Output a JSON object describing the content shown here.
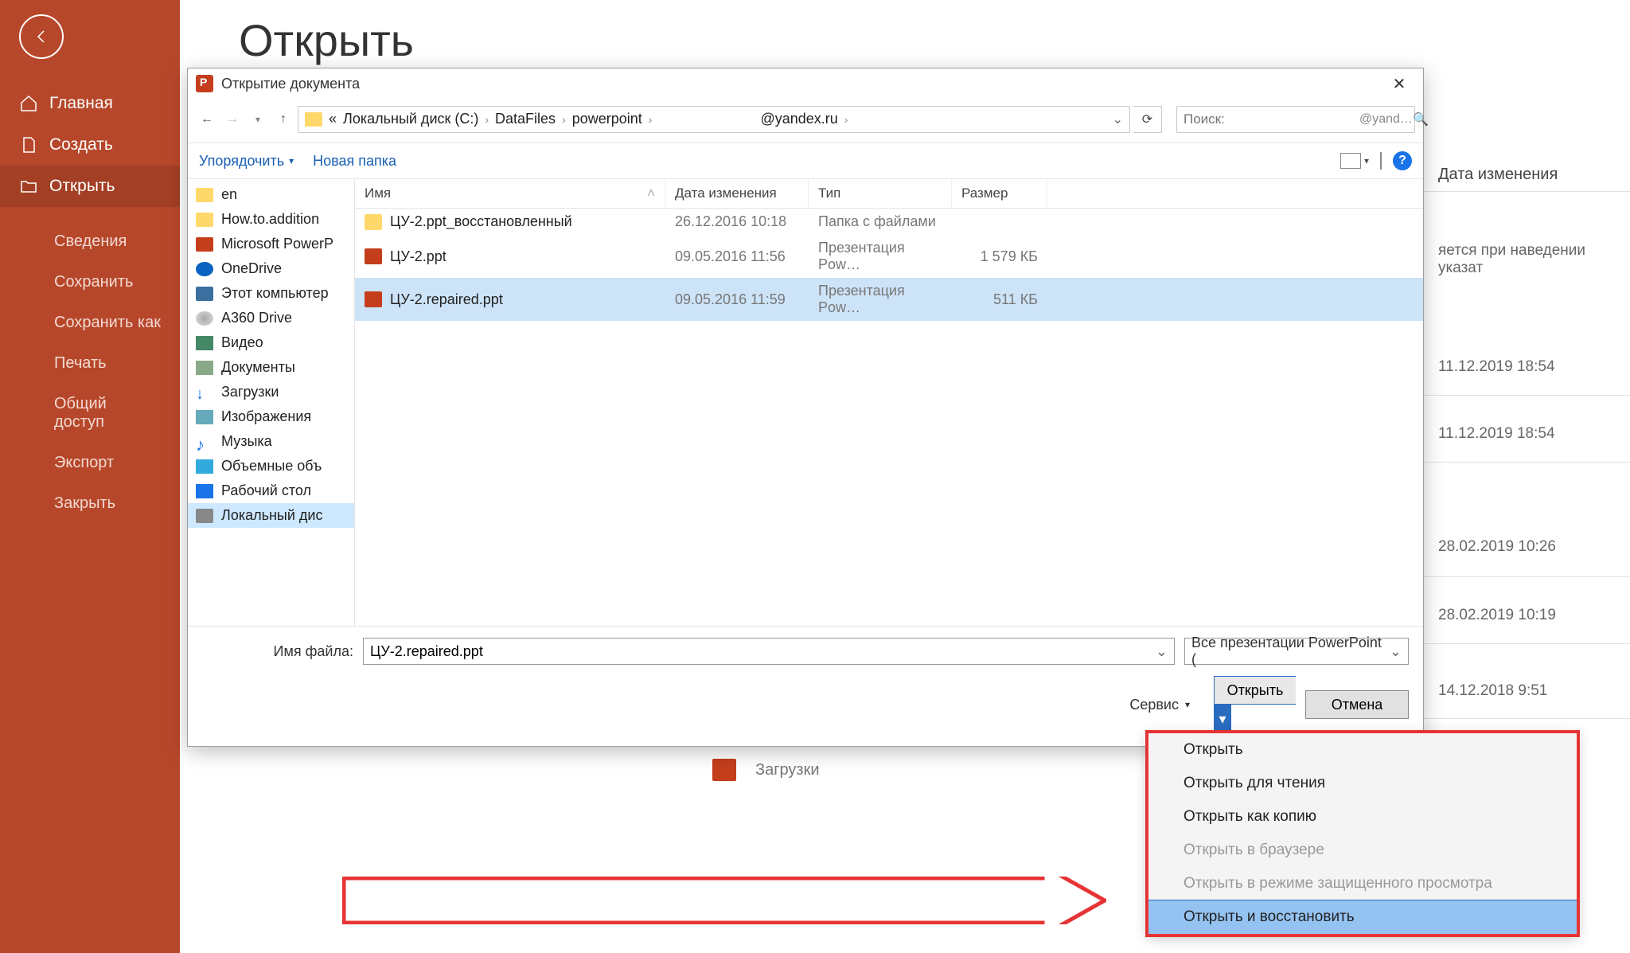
{
  "sidebar": {
    "items": [
      {
        "label": "Главная"
      },
      {
        "label": "Создать"
      },
      {
        "label": "Открыть"
      },
      {
        "label": "Сведения"
      },
      {
        "label": "Сохранить"
      },
      {
        "label": "Сохранить как"
      },
      {
        "label": "Печать"
      },
      {
        "label": "Общий доступ"
      },
      {
        "label": "Экспорт"
      },
      {
        "label": "Закрыть"
      }
    ]
  },
  "page": {
    "title": "Открыть"
  },
  "background": {
    "column_header": "Дата изменения",
    "hint_fragment": "яется при наведении указат",
    "dates": [
      "11.12.2019 18:54",
      "11.12.2019 18:54",
      "28.02.2019 10:26",
      "28.02.2019 10:19",
      "14.12.2018 9:51"
    ],
    "loads_label": "Загрузки"
  },
  "dialog": {
    "title": "Открытие документа",
    "breadcrumb": {
      "prefix": "«",
      "parts": [
        "Локальный диск (C:)",
        "DataFiles",
        "powerpoint",
        "@yandex.ru"
      ]
    },
    "search": {
      "placeholder": "Поиск:",
      "suffix": "@yand…"
    },
    "toolbar": {
      "organize": "Упорядочить",
      "newfolder": "Новая папка"
    },
    "tree": [
      {
        "label": "en",
        "icon": "ico-folder"
      },
      {
        "label": "How.to.addition",
        "icon": "ico-folder"
      },
      {
        "label": "Microsoft PowerP",
        "icon": "ico-ppt"
      },
      {
        "label": "OneDrive",
        "icon": "ico-cloud"
      },
      {
        "label": "Этот компьютер",
        "icon": "ico-pc"
      },
      {
        "label": "A360 Drive",
        "icon": "ico-a360"
      },
      {
        "label": "Видео",
        "icon": "ico-vid"
      },
      {
        "label": "Документы",
        "icon": "ico-doc"
      },
      {
        "label": "Загрузки",
        "icon": "ico-dl"
      },
      {
        "label": "Изображения",
        "icon": "ico-img"
      },
      {
        "label": "Музыка",
        "icon": "ico-music"
      },
      {
        "label": "Объемные объ",
        "icon": "ico-3d"
      },
      {
        "label": "Рабочий стол",
        "icon": "ico-desk"
      },
      {
        "label": "Локальный дис",
        "icon": "ico-disk",
        "selected": true
      }
    ],
    "columns": {
      "name": "Имя",
      "date": "Дата изменения",
      "type": "Тип",
      "size": "Размер"
    },
    "files": [
      {
        "name": "ЦУ-2.ppt_восстановленный",
        "date": "26.12.2016 10:18",
        "type": "Папка с файлами",
        "size": "",
        "icon": "ico-folder"
      },
      {
        "name": "ЦУ-2.ppt",
        "date": "09.05.2016 11:56",
        "type": "Презентация Pow…",
        "size": "1 579 КБ",
        "icon": "ico-ppt"
      },
      {
        "name": "ЦУ-2.repaired.ppt",
        "date": "09.05.2016 11:59",
        "type": "Презентация Pow…",
        "size": "511 КБ",
        "icon": "ico-ppt",
        "selected": true
      }
    ],
    "footer": {
      "fname_label": "Имя файла:",
      "fname_value": "ЦУ-2.repaired.ppt",
      "filter": "Все презентации PowerPoint (",
      "tools": "Сервис",
      "open": "Открыть",
      "cancel": "Отмена"
    }
  },
  "menu": {
    "items": [
      {
        "label": "Открыть",
        "state": ""
      },
      {
        "label": "Открыть для чтения",
        "state": ""
      },
      {
        "label": "Открыть как копию",
        "state": ""
      },
      {
        "label": "Открыть в браузере",
        "state": "disabled"
      },
      {
        "label": "Открыть в режиме защищенного просмотра",
        "state": "disabled"
      },
      {
        "label": "Открыть и восстановить",
        "state": "hl"
      }
    ]
  }
}
